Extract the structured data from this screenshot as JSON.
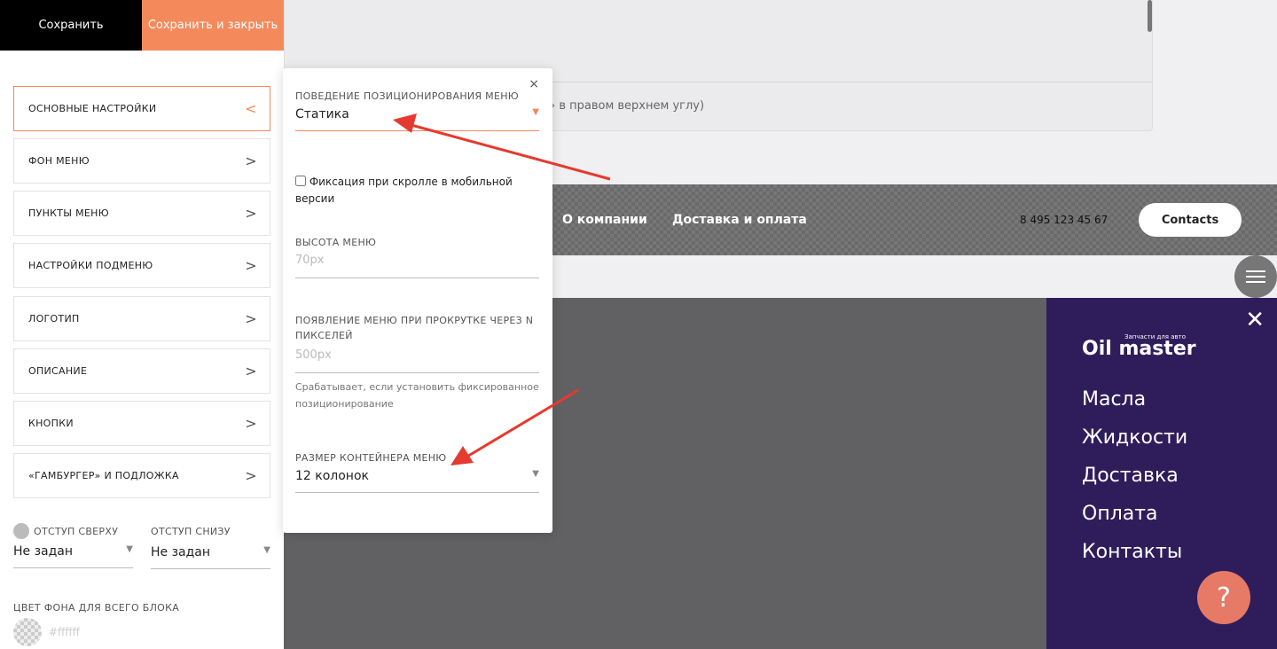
{
  "toolbar": {
    "save": "Сохранить",
    "save_close": "Сохранить и закрыть"
  },
  "sidebar": {
    "items": [
      {
        "label": "ОСНОВНЫЕ НАСТРОЙКИ",
        "chevron": "<"
      },
      {
        "label": "ФОН МЕНЮ",
        "chevron": ">"
      },
      {
        "label": "ПУНКТЫ МЕНЮ",
        "chevron": ">"
      },
      {
        "label": "НАСТРОЙКИ ПОДМЕНЮ",
        "chevron": ">"
      },
      {
        "label": "ЛОГОТИП",
        "chevron": ">"
      },
      {
        "label": "ОПИСАНИЕ",
        "chevron": ">"
      },
      {
        "label": "КНОПКИ",
        "chevron": ">"
      },
      {
        "label": "«ГАМБУРГЕР» И ПОДЛОЖКА",
        "chevron": ">"
      }
    ],
    "padding_top": {
      "label": "ОТСТУП СВЕРХУ",
      "value": "Не задан"
    },
    "padding_bottom": {
      "label": "ОТСТУП СНИЗУ",
      "value": "Не задан"
    },
    "bg_color": {
      "label": "ЦВЕТ ФОНА ДЛЯ ВСЕГО БЛОКА",
      "value": "#ffffff"
    }
  },
  "top_card": {
    "hint": "› в правом верхнем углу)"
  },
  "popup": {
    "close": "×",
    "positioning": {
      "label": "ПОВЕДЕНИЕ ПОЗИЦИОНИРОВАНИЯ МЕНЮ",
      "value": "Статика"
    },
    "fix_mobile": {
      "label": "Фиксация при скролле в мобильной версии",
      "checked": false
    },
    "height": {
      "label": "ВЫСОТА МЕНЮ",
      "placeholder": "70px"
    },
    "appear": {
      "label": "ПОЯВЛЕНИЕ МЕНЮ ПРИ ПРОКРУТКЕ ЧЕРЕЗ N ПИКСЕЛЕЙ",
      "placeholder": "500px",
      "note": "Срабатывает, если установить фиксированное позиционирование"
    },
    "container": {
      "label": "РАЗМЕР КОНТЕЙНЕРА МЕНЮ",
      "value": "12 колонок"
    }
  },
  "preview": {
    "nav": [
      "О компании",
      "Доставка и оплата"
    ],
    "phone": "8 495 123 45 67",
    "contacts": "Contacts",
    "mobile_menu": {
      "logo": "Oil master",
      "logo_tagline": "Запчасти для авто",
      "items": [
        "Масла",
        "Жидкости",
        "Доставка",
        "Оплата",
        "Контакты"
      ]
    },
    "help": "?"
  },
  "colors": {
    "accent": "#f48a5c",
    "menu_bg": "#2f1d5b",
    "arrow": "#e53a2f"
  }
}
